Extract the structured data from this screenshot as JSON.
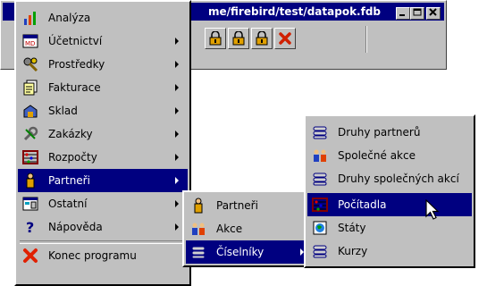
{
  "window": {
    "title": "me/firebird/test/datapok.fdb",
    "caption_buttons": [
      "minimize",
      "maximize",
      "close"
    ]
  },
  "toolbar": {
    "buttons": [
      "lock-icon",
      "lock-icon",
      "lock-icon",
      "delete-icon"
    ]
  },
  "main_menu": {
    "items": [
      {
        "label": "Analýza",
        "icon": "chart-icon",
        "submenu": false
      },
      {
        "label": "Účetnictví",
        "icon": "ledger-icon",
        "submenu": true
      },
      {
        "label": "Prostředky",
        "icon": "tools-icon",
        "submenu": true
      },
      {
        "label": "Fakturace",
        "icon": "invoice-icon",
        "submenu": true
      },
      {
        "label": "Sklad",
        "icon": "warehouse-icon",
        "submenu": true
      },
      {
        "label": "Zakázky",
        "icon": "wrench-icon",
        "submenu": true
      },
      {
        "label": "Rozpočty",
        "icon": "abacus-icon",
        "submenu": true
      },
      {
        "label": "Partneři",
        "icon": "person-icon",
        "submenu": true,
        "selected": true
      },
      {
        "label": "Ostatní",
        "icon": "window-icon",
        "submenu": true
      },
      {
        "label": "Nápověda",
        "icon": "help-icon",
        "submenu": true
      },
      {
        "label": "Konec programu",
        "icon": "exit-icon",
        "submenu": false
      }
    ]
  },
  "partneri_menu": {
    "items": [
      {
        "label": "Partneři",
        "icon": "person-icon",
        "submenu": false
      },
      {
        "label": "Akce",
        "icon": "people-icon",
        "submenu": false
      },
      {
        "label": "Číselníky",
        "icon": "list-icon",
        "submenu": true,
        "selected": true
      }
    ]
  },
  "ciselniky_menu": {
    "items": [
      {
        "label": "Druhy partnerů",
        "icon": "list-icon"
      },
      {
        "label": "Společné akce",
        "icon": "people-icon"
      },
      {
        "label": "Druhy společných akcí",
        "icon": "list-icon"
      },
      {
        "label": "Počítadla",
        "icon": "abacus-icon",
        "selected": true
      },
      {
        "label": "Státy",
        "icon": "globe-icon"
      },
      {
        "label": "Kurzy",
        "icon": "list-icon"
      }
    ]
  },
  "colors": {
    "menu_bg": "#c0c0c0",
    "highlight": "#000080",
    "highlight_text": "#ffffff"
  }
}
